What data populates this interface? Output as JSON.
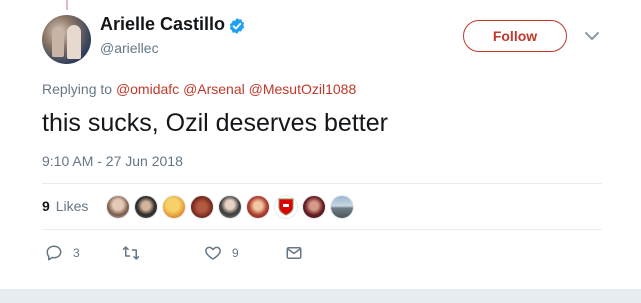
{
  "author": {
    "name": "Arielle Castillo",
    "handle": "@ariellec"
  },
  "follow_label": "Follow",
  "replying": {
    "prefix": "Replying to",
    "mentions": [
      "@omidafc",
      "@Arsenal",
      "@MesutOzil1088"
    ]
  },
  "tweet_text": "this sucks, Ozil deserves better",
  "timestamp": "9:10 AM - 27 Jun 2018",
  "likes": {
    "count": "9",
    "label": "Likes"
  },
  "actions": {
    "reply_count": "3",
    "retweet_count": "",
    "like_count": "9"
  },
  "colors": {
    "accent": "#c0392b",
    "verified": "#1da1f2",
    "muted": "#657786"
  },
  "icons": [
    "verified-badge-icon",
    "chevron-down-icon",
    "reply-icon",
    "retweet-icon",
    "heart-icon",
    "envelope-icon"
  ]
}
